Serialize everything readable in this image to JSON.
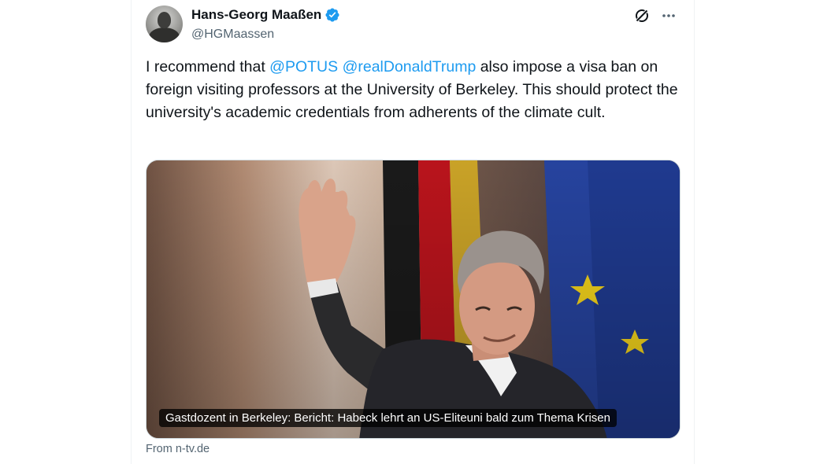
{
  "tweet": {
    "author": {
      "name": "Hans-Georg Maaßen",
      "handle": "@HGMaassen",
      "verified": true
    },
    "text_segments": {
      "intro": "I recommend that ",
      "mention1": "@POTUS",
      "space": " ",
      "mention2": "@realDonaldTrump",
      "rest": " also impose a visa ban on foreign visiting professors at the University of Berkeley. This should protect the university's academic credentials from adherents of the climate cult."
    },
    "card": {
      "caption": "Gastdozent in Berkeley: Bericht: Habeck lehrt an US-Eliteuni bald zum Thema Krisen",
      "source": "From n-tv.de"
    },
    "icons": {
      "verified": "verified-badge-icon",
      "grok": "grok-icon",
      "more": "more-options-icon"
    },
    "colors": {
      "link": "#1d9bf0",
      "text": "#0f1419",
      "secondary": "#536471"
    }
  }
}
